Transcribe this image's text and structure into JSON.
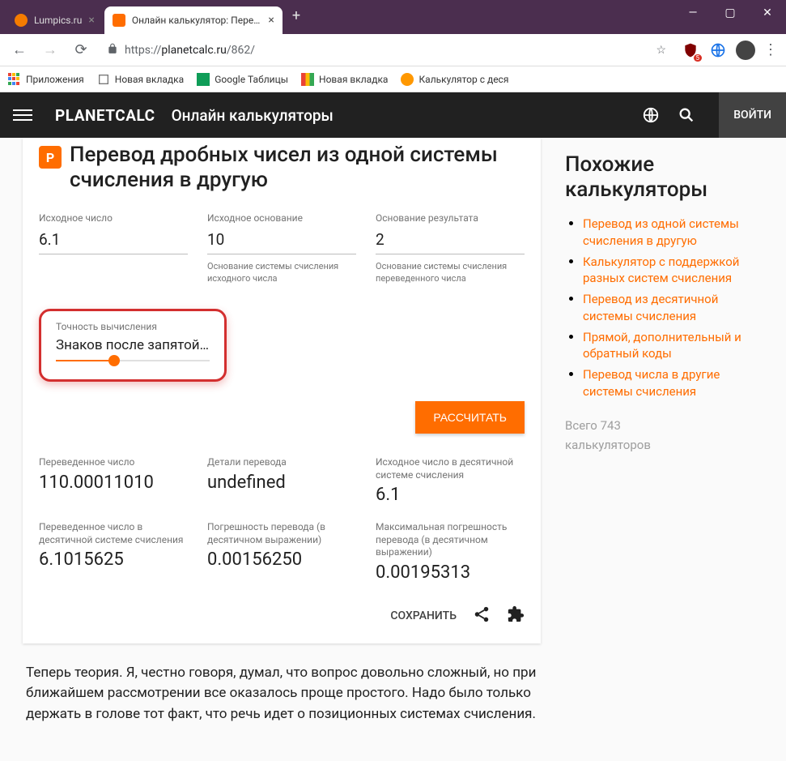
{
  "browser": {
    "tabs": [
      {
        "title": "Lumpics.ru",
        "favicon": "#f57c00",
        "active": false
      },
      {
        "title": "Онлайн калькулятор: Перевод /",
        "favicon": "#ff6d00",
        "active": true
      }
    ],
    "url_proto": "https://",
    "url_domain": "planetcalc.ru",
    "url_path": "/862/",
    "ublock_badge": "5",
    "bookmarks": [
      {
        "label": "Приложения"
      },
      {
        "label": "Новая вкладка"
      },
      {
        "label": "Google Таблицы"
      },
      {
        "label": "Новая вкладка"
      },
      {
        "label": "Калькулятор с деся"
      }
    ]
  },
  "header": {
    "brand": "PLANETCALC",
    "subtitle": "Онлайн калькуляторы",
    "login": "ВОЙТИ"
  },
  "calc": {
    "icon_letter": "P",
    "title": "Перевод дробных чисел из одной системы счисления в другую",
    "inputs": {
      "source_number": {
        "label": "Исходное число",
        "value": "6.1"
      },
      "source_base": {
        "label": "Исходное основание",
        "value": "10",
        "hint": "Основание системы счисления исходного числа"
      },
      "target_base": {
        "label": "Основание результата",
        "value": "2",
        "hint": "Основание системы счисления переведенного числа"
      }
    },
    "precision": {
      "label": "Точность вычисления",
      "text": "Знаков после запятой…"
    },
    "button": "РАССЧИТАТЬ",
    "results": {
      "r1": {
        "label": "Переведенное число",
        "value": "110.00011010"
      },
      "r2": {
        "label": "Детали перевода",
        "value": "undefined"
      },
      "r3": {
        "label": "Исходное число в десятичной системе счисления",
        "value": "6.1"
      },
      "r4": {
        "label": "Переведенное число в десятичной системе счисления",
        "value": "6.1015625"
      },
      "r5": {
        "label": "Погрешность перевода (в десятичном выражении)",
        "value": "0.00156250"
      },
      "r6": {
        "label": "Максимальная погрешность перевода (в десятичном выражении)",
        "value": "0.00195313"
      }
    },
    "save": "СОХРАНИТЬ"
  },
  "theory": "Теперь теория. Я, честно говоря, думал, что вопрос довольно сложный, но при ближайшем рассмотрении все оказалось проще простого. Надо было только держать в голове тот факт, что речь идет о позиционных системах счисления.",
  "sidebar": {
    "title": "Похожие калькуляторы",
    "links": [
      "Перевод из одной системы счисления в другую",
      "Калькулятор с поддержкой разных систем счисления",
      "Перевод из десятичной системы счисления",
      "Прямой, дополнительный и обратный коды",
      "Перевод числа в другие системы счисления"
    ],
    "footer1": "Всего 743",
    "footer2": "калькуляторов"
  }
}
